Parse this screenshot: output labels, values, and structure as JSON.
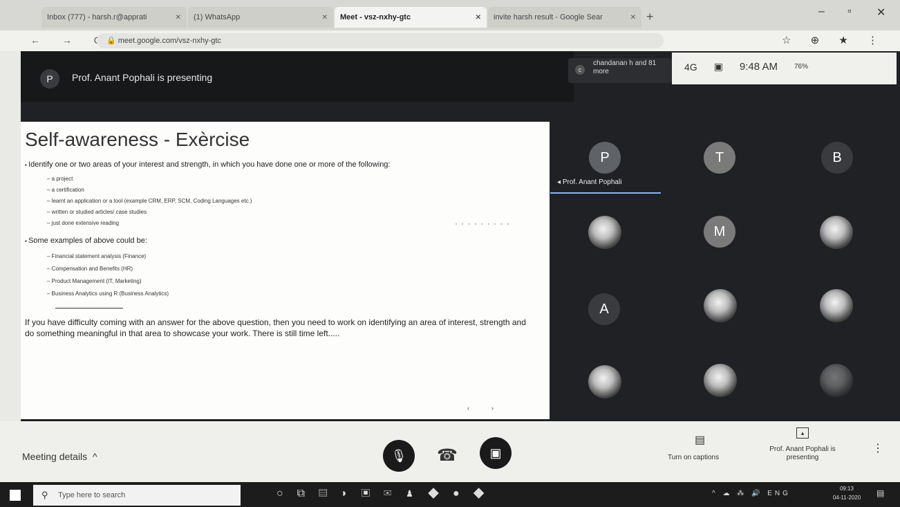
{
  "browser": {
    "tabs": [
      {
        "title": "Inbox (777) - harsh.r@apprati"
      },
      {
        "title": "(1) WhatsApp"
      },
      {
        "title": "Meet - vsz-nxhy-gtc"
      },
      {
        "title": "invite harsh result - Google Sear"
      }
    ],
    "new_tab": "+",
    "url": "meet.google.com/vsz-nxhy-gtc",
    "window_controls": [
      "–",
      "▫",
      "✕"
    ],
    "nav_glyphs": "← → C",
    "extension_glyphs": "☆ ⊕ ★ ⋮"
  },
  "meet": {
    "presenter_initial": "P",
    "presenting_banner": "Prof. Anant Pophali is presenting",
    "chat_chip": {
      "initial": "c",
      "text": "chandanan h and 81 more"
    },
    "overlay": {
      "signal": "4G",
      "time": "9:48 AM",
      "battery": "76%"
    },
    "slide": {
      "title": "Self-awareness - Exèrcise",
      "bullets": [
        "Identify one or two areas of your interest and strength, in which you have done one or more of the following:",
        "Some examples of above could be:"
      ],
      "sub_items_1": [
        "a project",
        "a certification",
        "learnt an application or a tool (example CRM, ERP, SCM, Coding Languages etc.)",
        "written or studied articles/ case studies",
        "just done extensive reading"
      ],
      "sub_items_2": [
        "Financial statement analysis (Finance)",
        "Compensation and Benefits (HR)",
        "Product Management (IT, Marketing)",
        "Business Analytics using R (Business Analytics)"
      ],
      "paragraph": "If you have difficulty coming with an answer for the above question, then you need to work on identifying an area of interest, strength and do something meaningful in that area to showcase your work. There is still time left.....",
      "pager": [
        "‹",
        "›"
      ],
      "dots": "· · · · · · · · ·"
    },
    "tiles": [
      {
        "initial": "P",
        "color": "#5f6368"
      },
      {
        "initial": "T",
        "color": "#7a7a7a"
      },
      {
        "initial": "B",
        "color": "#3a3b3e"
      },
      {
        "initial": "M",
        "color": "#7a7a7a"
      },
      {
        "initial": "A",
        "color": "#3a3b3e"
      }
    ],
    "presenter_tile_label": "Prof. Anant Pophali"
  },
  "bottombar": {
    "meeting_details": "Meeting details",
    "chevron": "^",
    "captions_label": "Turn on captions",
    "present_label": "Prof. Anant Pophali is presenting",
    "more": "⋮"
  },
  "taskbar": {
    "search_placeholder": "Type here to search",
    "tray": "^ ☁ ⁂ 🔊 ENG",
    "time": "09:13",
    "date": "04-11-2020"
  }
}
